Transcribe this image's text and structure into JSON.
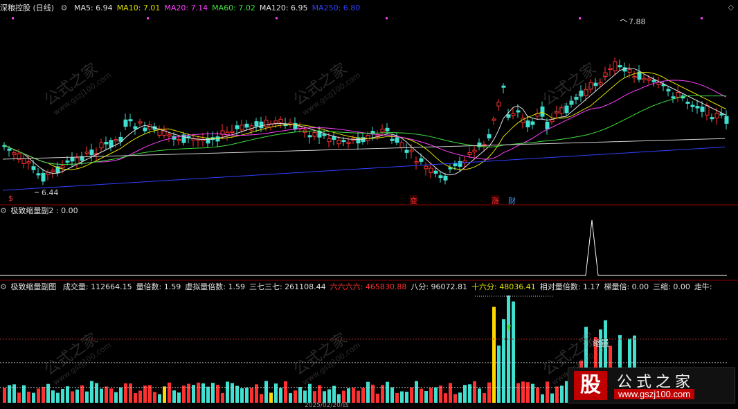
{
  "main_panel": {
    "title": "深粮控股 (日线)",
    "indicators": [
      {
        "label": "MA5: 6.94",
        "color": "#e0e0e0"
      },
      {
        "label": "MA10: 7.01",
        "color": "#e0e000"
      },
      {
        "label": "MA20: 7.14",
        "color": "#ff40ff"
      },
      {
        "label": "MA60: 7.02",
        "color": "#40e040"
      },
      {
        "label": "MA120: 6.95",
        "color": "#e0e0e0"
      },
      {
        "label": "MA250: 6.80",
        "color": "#3040ff"
      }
    ],
    "high_label": "7.88",
    "low_label": "6.44",
    "markers": [
      "$",
      "变",
      "涨",
      "财"
    ]
  },
  "sub1": {
    "title": "极致缩量副2",
    "value": ": 0.00"
  },
  "sub2": {
    "title": "极致缩量副图",
    "stats": [
      {
        "label": "成交量: 112664.15",
        "color": "#e0e0e0"
      },
      {
        "label": "量倍数: 1.59",
        "color": "#e0e0e0"
      },
      {
        "label": "虚拟量倍数: 1.59",
        "color": "#e0e0e0"
      },
      {
        "label": "三七三七: 261108.44",
        "color": "#e0e0e0"
      },
      {
        "label": "六六六六: 465830.88",
        "color": "#ff3030"
      },
      {
        "label": "八分: 96072.81",
        "color": "#e0e0e0"
      },
      {
        "label": "十六分: 48036.41",
        "color": "#e0e000"
      },
      {
        "label": "相对量倍数: 1.17",
        "color": "#e0e0e0"
      },
      {
        "label": "梯量倍: 0.00",
        "color": "#e0e0e0"
      },
      {
        "label": "三缩: 0.00",
        "color": "#e0e0e0"
      },
      {
        "label": "走牛:",
        "color": "#e0e0e0"
      }
    ],
    "annotation": "缩量",
    "date_label": "2025/02/20/四"
  },
  "watermark": {
    "text": "公式之家",
    "url": "www.gszj100.com"
  },
  "logo": {
    "big": "股",
    "name": "公式之家",
    "site": "www.gszj100.com"
  },
  "colors": {
    "up": "#ff3030",
    "down": "#40e0d0",
    "background": "#000000"
  }
}
